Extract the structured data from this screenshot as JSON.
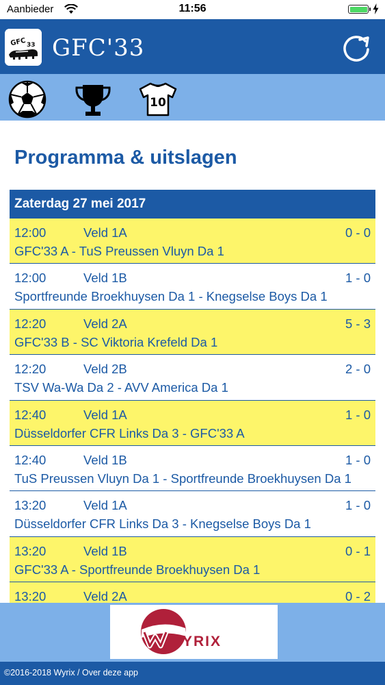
{
  "status_bar": {
    "carrier": "Aanbieder",
    "time": "11:56",
    "battery_level": 1.0,
    "battery_color": "#4cd964"
  },
  "header": {
    "title": "GFC'33",
    "logo_icon": "club-logo-icon",
    "refresh_icon": "refresh-icon",
    "background": "#1c5aa5"
  },
  "tabs": [
    {
      "icon": "football-icon"
    },
    {
      "icon": "trophy-icon"
    },
    {
      "icon": "jersey-icon",
      "badge_text": "10"
    }
  ],
  "page": {
    "title": "Programma & uitslagen"
  },
  "schedule": {
    "date": "Zaterdag 27 mei 2017",
    "matches": [
      {
        "time": "12:00",
        "field": "Veld 1A",
        "score": "0 - 0",
        "teams": "GFC'33 A - TuS Preussen Vluyn Da 1",
        "highlight": true
      },
      {
        "time": "12:00",
        "field": "Veld 1B",
        "score": "1 - 0",
        "teams": "Sportfreunde Broekhuysen Da 1 - Knegselse Boys Da 1",
        "highlight": false
      },
      {
        "time": "12:20",
        "field": "Veld 2A",
        "score": "5 - 3",
        "teams": "GFC'33 B - SC Viktoria Krefeld Da 1",
        "highlight": true
      },
      {
        "time": "12:20",
        "field": "Veld 2B",
        "score": "2 - 0",
        "teams": "TSV Wa-Wa Da 2 - AVV America Da 1",
        "highlight": false
      },
      {
        "time": "12:40",
        "field": "Veld 1A",
        "score": "1 - 0",
        "teams": "Düsseldorfer CFR Links Da 3 - GFC'33 A",
        "highlight": true
      },
      {
        "time": "12:40",
        "field": "Veld 1B",
        "score": "1 - 0",
        "teams": "TuS Preussen Vluyn Da 1 - Sportfreunde Broekhuysen Da 1",
        "highlight": false
      },
      {
        "time": "13:20",
        "field": "Veld 1A",
        "score": "1 - 0",
        "teams": "Düsseldorfer CFR Links Da 3 - Knegselse Boys Da 1",
        "highlight": false
      },
      {
        "time": "13:20",
        "field": "Veld 1B",
        "score": "0 - 1",
        "teams": "GFC'33 A - Sportfreunde Broekhuysen Da 1",
        "highlight": true
      },
      {
        "time": "13:20",
        "field": "Veld 2A",
        "score": "0 - 2",
        "teams": "",
        "highlight": true
      }
    ]
  },
  "ad": {
    "brand": "YRIX",
    "logo_icon": "wyrix-logo-icon",
    "brand_color": "#b0203a"
  },
  "footer": {
    "text": "©2016-2018 Wyrix / Over deze app"
  }
}
